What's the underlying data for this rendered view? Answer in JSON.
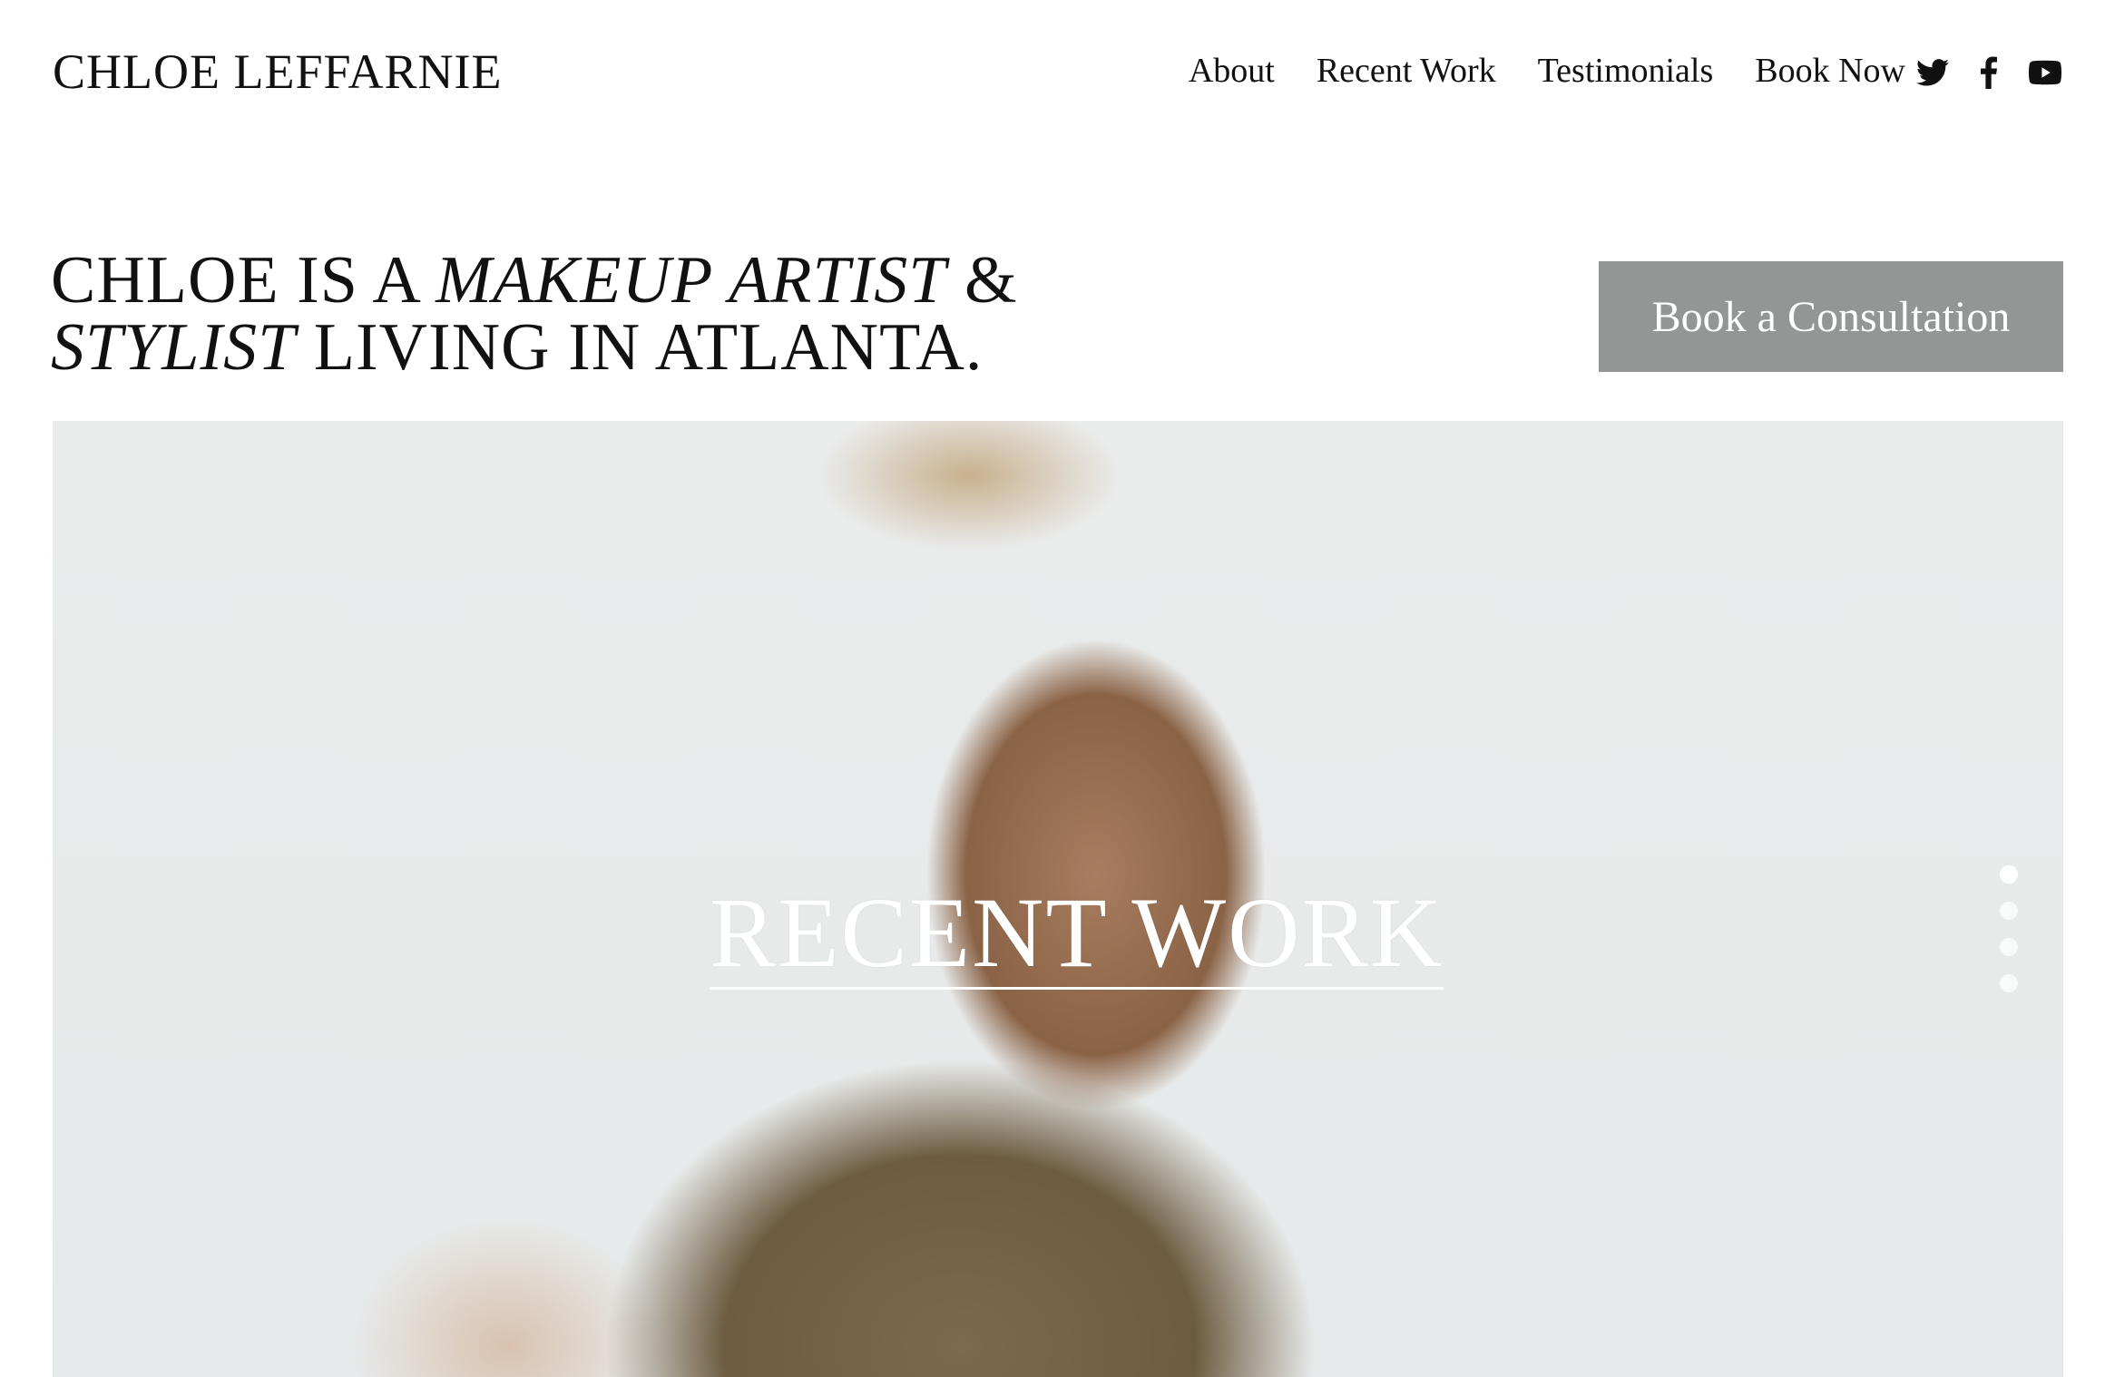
{
  "header": {
    "site_title": "CHLOE LEFFARNIE",
    "nav": [
      {
        "label": "About"
      },
      {
        "label": "Recent Work"
      },
      {
        "label": "Testimonials"
      },
      {
        "label": "Book Now"
      }
    ],
    "social_icons": [
      "twitter-icon",
      "facebook-icon",
      "youtube-icon"
    ]
  },
  "headline": {
    "line1_a": "CHLOE IS A ",
    "line1_b": "MAKEUP ARTIST",
    "line1_c": " &",
    "line2_a": "STYLIST",
    "line2_b": " LIVING IN ATLANTA."
  },
  "cta": {
    "label": "Book a Consultation",
    "color": "#939695"
  },
  "hero": {
    "title": "RECENT WORK",
    "slide_count": 4,
    "active_slide": 1
  }
}
